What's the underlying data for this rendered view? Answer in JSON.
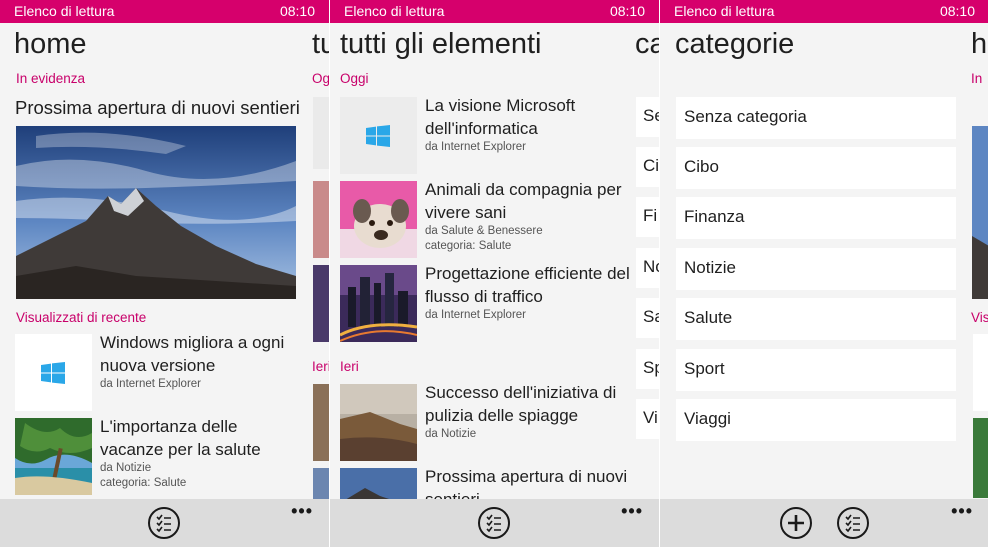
{
  "status_bar": {
    "app_name": "Elenco di lettura",
    "time": "08:10"
  },
  "home": {
    "title": "home",
    "peek_title": "tu",
    "featured_section": "In evidenza",
    "featured_title": "Prossima apertura di nuovi sentieri",
    "recent_section": "Visualizzati di recente",
    "peek_sections": [
      "Ogg",
      "Ieri"
    ],
    "items": [
      {
        "title": "Windows migliora a ogni nuova versione",
        "source": "da Internet Explorer",
        "category": ""
      },
      {
        "title": "L'importanza delle vacanze per la salute",
        "source": "da Notizie",
        "category": "categoria: Salute"
      }
    ]
  },
  "all_items": {
    "title": "tutti gli elementi",
    "peek_title": "ca",
    "today_section": "Oggi",
    "yesterday_section": "Ieri",
    "today": [
      {
        "title": "La visione Microsoft dell'informatica",
        "source": "da Internet Explorer",
        "category": ""
      },
      {
        "title": "Animali da compagnia per vivere sani",
        "source": "da Salute & Benessere",
        "category": "categoria: Salute"
      },
      {
        "title": "Progettazione efficiente del flusso di traffico",
        "source": "da Internet Explorer",
        "category": ""
      }
    ],
    "yesterday": [
      {
        "title": "Successo dell'iniziativa di pulizia delle spiagge",
        "source": "da Notizie",
        "category": ""
      },
      {
        "title": "Prossima apertura di nuovi sentieri",
        "source": "",
        "category": ""
      }
    ],
    "peek_categories": [
      "Se",
      "Ci",
      "Fi",
      "No",
      "Sa",
      "Sp",
      "Vi"
    ]
  },
  "categories": {
    "title": "categorie",
    "peek_title": "h",
    "peek_sections": [
      "In",
      "Visi"
    ],
    "items": [
      "Senza categoria",
      "Cibo",
      "Finanza",
      "Notizie",
      "Salute",
      "Sport",
      "Viaggi"
    ]
  },
  "appbar": {
    "more": "•••"
  },
  "colors": {
    "accent": "#d6006c",
    "section": "#c8006a",
    "windows_logo": "#2aa7e8"
  }
}
